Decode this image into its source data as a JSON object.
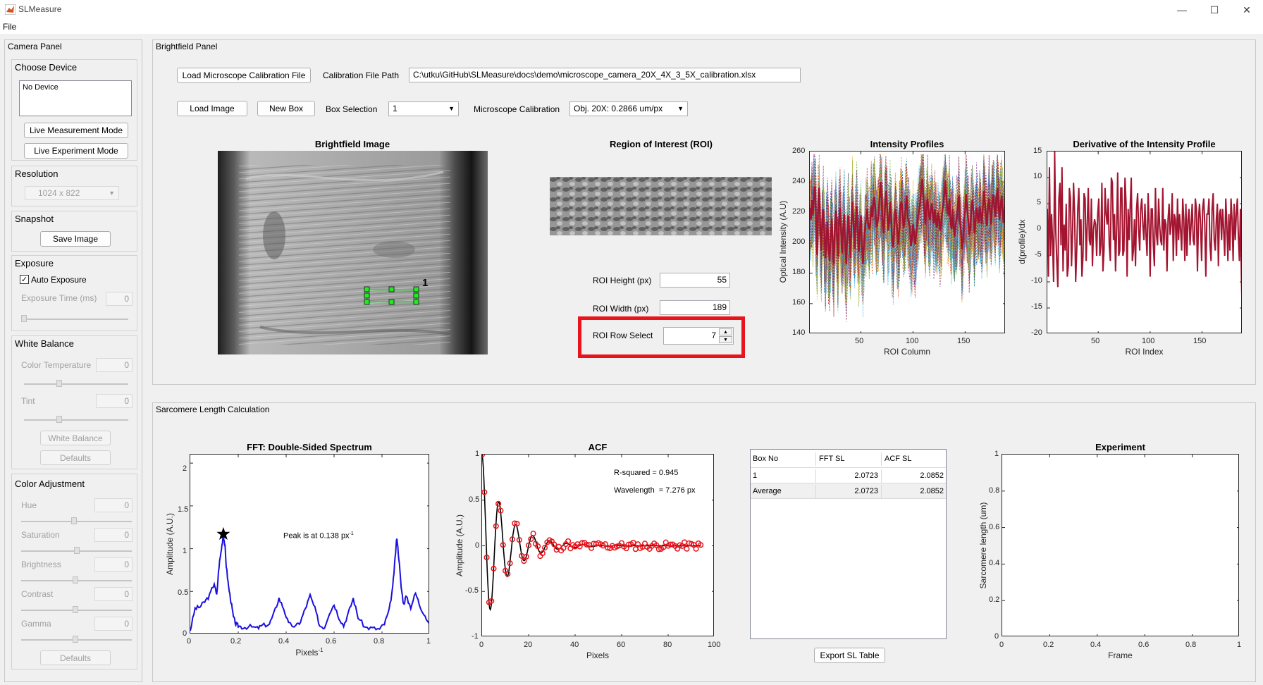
{
  "window": {
    "title": "SLMeasure",
    "controls": [
      "—",
      "☐",
      "✕"
    ]
  },
  "menu": {
    "file": "File"
  },
  "camera_panel": {
    "title": "Camera Panel",
    "choose_device": {
      "title": "Choose Device",
      "device_list": "No Device",
      "live_measurement": "Live Measurement Mode",
      "live_experiment": "Live Experiment Mode"
    },
    "resolution": {
      "title": "Resolution",
      "value": "1024 x 822"
    },
    "snapshot": {
      "title": "Snapshot",
      "save_image": "Save Image"
    },
    "exposure": {
      "title": "Exposure",
      "auto_exposure": "Auto Exposure",
      "exposure_time_label": "Exposure Time (ms)",
      "exposure_time": "0"
    },
    "white_balance": {
      "title": "White Balance",
      "color_temp_label": "Color Temperature",
      "color_temp": "0",
      "tint_label": "Tint",
      "tint": "0",
      "white_balance_btn": "White Balance",
      "defaults_btn": "Defaults"
    },
    "color_adjustment": {
      "title": "Color Adjustment",
      "items": [
        {
          "label": "Hue",
          "value": "0"
        },
        {
          "label": "Saturation",
          "value": "0"
        },
        {
          "label": "Brightness",
          "value": "0"
        },
        {
          "label": "Contrast",
          "value": "0"
        },
        {
          "label": "Gamma",
          "value": "0"
        }
      ],
      "defaults_btn": "Defaults"
    }
  },
  "brightfield_panel": {
    "title": "Brightfield Panel",
    "load_calibration": "Load Microscope Calibration File",
    "calibration_path_label": "Calibration File Path",
    "calibration_path": "C:\\utku\\GitHub\\SLMeasure\\docs\\demo\\microscope_camera_20X_4X_3_5X_calibration.xlsx",
    "load_image": "Load Image",
    "new_box": "New Box",
    "box_selection_label": "Box Selection",
    "box_selection": "1",
    "microscope_calibration_label": "Microscope Calibration",
    "microscope_calibration": "Obj. 20X: 0.2866 um/px",
    "brightfield_image_title": "Brightfield Image",
    "box_number": "1",
    "roi_title": "Region of Interest (ROI)",
    "roi_height_label": "ROI Height (px)",
    "roi_height": "55",
    "roi_width_label": "ROI Width (px)",
    "roi_width": "189",
    "roi_row_label": "ROI Row Select",
    "roi_row": "7",
    "highlight_color": "#e8141c"
  },
  "sarcomere_panel": {
    "title": "Sarcomere Length Calculation",
    "table": {
      "headers": [
        "Box No",
        "FFT SL",
        "ACF SL"
      ],
      "rows": [
        [
          "1",
          "2.0723",
          "2.0852"
        ],
        [
          "Average",
          "2.0723",
          "2.0852"
        ]
      ]
    },
    "export_btn": "Export SL Table"
  },
  "chart_data": [
    {
      "type": "line",
      "title": "Intensity Profiles",
      "xlabel": "ROI Column",
      "ylabel": "Optical Intensity (A.U)",
      "xlim": [
        1,
        189
      ],
      "ylim": [
        140,
        260
      ],
      "xticks": [
        "50",
        "100",
        "150"
      ],
      "yticks": [
        "140",
        "160",
        "180",
        "200",
        "220",
        "240",
        "260"
      ],
      "series": [
        {
          "color": "#a2142f",
          "style": "solid",
          "values": [
            223,
            215,
            228,
            218,
            233,
            237,
            214,
            192,
            226,
            236,
            210,
            195,
            215,
            222,
            205,
            190,
            204,
            214,
            197,
            188,
            205,
            216,
            200,
            186,
            210,
            221,
            205,
            191,
            213,
            223,
            207,
            193,
            209,
            219,
            196,
            186,
            206,
            218,
            203,
            190,
            214,
            227,
            212,
            196,
            213,
            224,
            210,
            194,
            208,
            218,
            198,
            186,
            199,
            210,
            216,
            222,
            212,
            209,
            214,
            224,
            217,
            228,
            230,
            221,
            210,
            213,
            219,
            231,
            240,
            228,
            212,
            206,
            221,
            234,
            226,
            208,
            214,
            227,
            219,
            201,
            197,
            209,
            222,
            218,
            207,
            199,
            211,
            225,
            227,
            220,
            210,
            215,
            224,
            231,
            216,
            214,
            210,
            198,
            202,
            212,
            207,
            199,
            205,
            211,
            218,
            222,
            227,
            237,
            242,
            230,
            219,
            212,
            225,
            229,
            220,
            215,
            221,
            226,
            219,
            213,
            222,
            214,
            210,
            220,
            216,
            208,
            212,
            220,
            225,
            232,
            241,
            230,
            222,
            218,
            229,
            214,
            209,
            222,
            210,
            204,
            212,
            216,
            225,
            231,
            214,
            209,
            196,
            201,
            214,
            220,
            232,
            222,
            215,
            205,
            209,
            222,
            228,
            220,
            206,
            214,
            223,
            218,
            213,
            224,
            219,
            212,
            223,
            234,
            227,
            218,
            211,
            224,
            229,
            219,
            212,
            226,
            232,
            224,
            217,
            228,
            236,
            226,
            215,
            224,
            231,
            220,
            213,
            225,
            232
          ]
        }
      ],
      "note": "plus many dotted multi-colored profiles"
    },
    {
      "type": "line",
      "title": "Derivative of the Intensity Profile",
      "xlabel": "ROI Index",
      "ylabel": "d(profile)/dx",
      "xlim": [
        1,
        189
      ],
      "ylim": [
        -20,
        15
      ],
      "xticks": [
        "50",
        "100",
        "150"
      ],
      "yticks": [
        "-20",
        "-15",
        "-10",
        "-5",
        "0",
        "5",
        "10",
        "15"
      ],
      "series": [
        {
          "color": "#a2142f",
          "values": [
            4,
            -9,
            12,
            -5,
            3,
            -2,
            -10,
            15,
            0,
            -6,
            -11,
            6,
            9,
            -3,
            12,
            -8,
            1,
            -4,
            5,
            -9,
            -7,
            8,
            6,
            -7,
            -1,
            9,
            3,
            -10,
            -4,
            4,
            8,
            -3,
            2,
            -9,
            -5,
            7,
            6,
            -6,
            1,
            8,
            -2,
            -3,
            6,
            -7,
            0,
            2,
            1,
            -5,
            3,
            6,
            -5,
            -3,
            9,
            -8,
            -4,
            8,
            3,
            1,
            6,
            -3,
            -6,
            10,
            9,
            -2,
            3,
            -8,
            0,
            11,
            -5,
            -4,
            8,
            8,
            -5,
            -4,
            10,
            5,
            -9,
            4,
            -2,
            5,
            10,
            -6,
            -4,
            2,
            -7,
            4,
            7,
            0,
            -4,
            4,
            6,
            1,
            -2,
            5,
            -1,
            -5,
            7,
            1,
            -9,
            4,
            4,
            -3,
            -7,
            8,
            -1,
            -3,
            6,
            1,
            -2,
            -3,
            8,
            -4,
            2,
            1,
            -8,
            2,
            5,
            -1,
            1,
            7,
            -6,
            3,
            2,
            -5,
            6,
            -2,
            3,
            0,
            -4,
            6,
            2,
            -6,
            5,
            -5,
            2,
            4,
            -3,
            1,
            5,
            -2,
            -3,
            6,
            4,
            -8,
            2,
            5,
            1,
            -6,
            4,
            6,
            1,
            -9,
            3,
            3,
            6,
            -3,
            -6,
            4,
            7,
            -2,
            -4,
            2,
            5,
            -7,
            3,
            4,
            -2,
            4,
            0,
            -5,
            6,
            1,
            -6,
            3,
            -4,
            6,
            2,
            -6,
            5,
            -2,
            3,
            6,
            -1,
            -6,
            4,
            -10,
            -18
          ]
        }
      ]
    },
    {
      "type": "line",
      "title": "FFT: Double-Sided Spectrum",
      "xlabel": "Pixels-1",
      "ylabel": "Amplitude (A.U.)",
      "xlim": [
        0,
        1
      ],
      "ylim": [
        0,
        2.1
      ],
      "xticks": [
        "0",
        "0.2",
        "0.4",
        "0.6",
        "0.8",
        "1"
      ],
      "yticks": [
        "0",
        "0.5",
        "1",
        "1.5",
        "2"
      ],
      "annotation": "Peak is at 0.138 px",
      "annotation_superscript": "-1",
      "peak": {
        "x": 0.138,
        "y": 1.17
      },
      "series": [
        {
          "color": "#1a0fe0",
          "x": [
            0,
            0.02,
            0.04,
            0.06,
            0.08,
            0.1,
            0.11,
            0.12,
            0.13,
            0.138,
            0.145,
            0.15,
            0.16,
            0.17,
            0.18,
            0.19,
            0.2,
            0.22,
            0.25,
            0.28,
            0.3,
            0.33,
            0.35,
            0.37,
            0.39,
            0.41,
            0.44,
            0.46,
            0.48,
            0.5,
            0.52,
            0.54,
            0.56,
            0.58,
            0.6,
            0.62,
            0.64,
            0.66,
            0.68,
            0.7,
            0.73,
            0.76,
            0.79,
            0.81,
            0.83,
            0.845,
            0.855,
            0.862,
            0.87,
            0.88,
            0.89,
            0.9,
            0.92,
            0.94,
            0.96,
            0.98,
            1.0
          ],
          "values": [
            0.05,
            0.3,
            0.32,
            0.38,
            0.45,
            0.6,
            0.45,
            0.8,
            1.0,
            1.17,
            1.02,
            0.8,
            0.55,
            0.38,
            0.2,
            0.12,
            0.1,
            0.08,
            0.09,
            0.07,
            0.1,
            0.12,
            0.25,
            0.42,
            0.3,
            0.12,
            0.09,
            0.15,
            0.3,
            0.45,
            0.3,
            0.1,
            0.08,
            0.25,
            0.35,
            0.2,
            0.1,
            0.25,
            0.42,
            0.2,
            0.08,
            0.07,
            0.06,
            0.12,
            0.28,
            0.55,
            0.9,
            1.14,
            0.9,
            0.55,
            0.35,
            0.44,
            0.32,
            0.48,
            0.32,
            0.22,
            0.08
          ]
        }
      ]
    },
    {
      "type": "scatter",
      "title": "ACF",
      "xlabel": "Pixels",
      "ylabel": "Amplitude (A.U.)",
      "xlim": [
        0,
        100
      ],
      "ylim": [
        -1,
        1
      ],
      "xticks": [
        "0",
        "20",
        "40",
        "60",
        "80",
        "100"
      ],
      "yticks": [
        "-1",
        "-0.5",
        "0",
        "0.5",
        "1"
      ],
      "annotations": [
        "R-squared = 0.945",
        "Wavelength  = 7.276 px"
      ],
      "wavelength": 7.276,
      "fit": {
        "color": "#000000",
        "amplitude": 1,
        "decay": 10
      },
      "points": {
        "color": "#e8141c",
        "x_step": 1,
        "x_max": 94
      }
    },
    {
      "type": "line",
      "title": "Experiment",
      "xlabel": "Frame",
      "ylabel": "Sarcomere length (um)",
      "xlim": [
        0,
        1
      ],
      "ylim": [
        0,
        1
      ],
      "xticks": [
        "0",
        "0.2",
        "0.4",
        "0.6",
        "0.8",
        "1"
      ],
      "yticks": [
        "0",
        "0.2",
        "0.4",
        "0.6",
        "0.8",
        "1"
      ],
      "series": []
    }
  ]
}
